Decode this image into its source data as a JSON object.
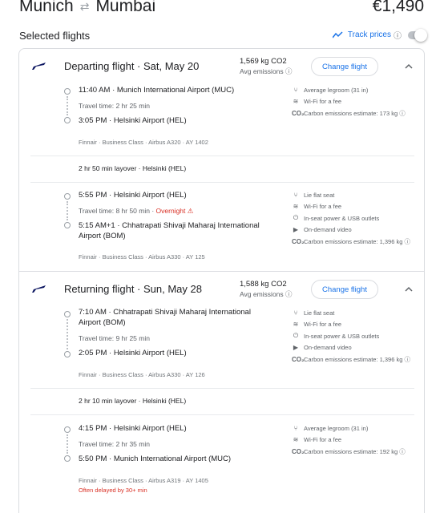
{
  "header": {
    "origin": "Munich",
    "destination": "Mumbai",
    "swap_icon": "swap-arrows-icon",
    "price": "€1,490"
  },
  "selected_title": "Selected flights",
  "track": {
    "label": "Track prices",
    "info_icon": "ⓘ"
  },
  "departing": {
    "title": "Departing flight · Sat, May 20",
    "co2": "1,569 kg CO2",
    "co2_sub": "Avg emissions ⓘ",
    "change": "Change flight",
    "seg1": {
      "dep_time_airport": "11:40 AM · Munich International Airport (MUC)",
      "travel": "Travel time: 2 hr 25 min",
      "arr_time_airport": "3:05 PM · Helsinki Airport (HEL)",
      "meta": "Finnair · Business Class · Airbus A320 · AY 1402",
      "amenities": [
        "Average legroom (31 in)",
        "Wi-Fi for a fee",
        "Carbon emissions estimate: 173 kg ⓘ"
      ]
    },
    "layover": "2 hr 50 min layover · Helsinki (HEL)",
    "seg2": {
      "dep_time_airport": "5:55 PM · Helsinki Airport (HEL)",
      "travel": "Travel time: 8 hr 50 min ·",
      "overnight": "Overnight",
      "arr_time_airport": "5:15 AM+1 · Chhatrapati Shivaji Maharaj International Airport (BOM)",
      "meta": "Finnair · Business Class · Airbus A330 · AY 125",
      "amenities": [
        "Lie flat seat",
        "Wi-Fi for a fee",
        "In-seat power & USB outlets",
        "On-demand video",
        "Carbon emissions estimate: 1,396 kg ⓘ"
      ]
    }
  },
  "returning": {
    "title": "Returning flight · Sun, May 28",
    "co2": "1,588 kg CO2",
    "co2_sub": "Avg emissions ⓘ",
    "change": "Change flight",
    "seg1": {
      "dep_time_airport": "7:10 AM · Chhatrapati Shivaji Maharaj International Airport (BOM)",
      "travel": "Travel time: 9 hr 25 min",
      "arr_time_airport": "2:05 PM · Helsinki Airport (HEL)",
      "meta": "Finnair · Business Class · Airbus A330 · AY 126",
      "amenities": [
        "Lie flat seat",
        "Wi-Fi for a fee",
        "In-seat power & USB outlets",
        "On-demand video",
        "Carbon emissions estimate: 1,396 kg ⓘ"
      ]
    },
    "layover": "2 hr 10 min layover · Helsinki (HEL)",
    "seg2": {
      "dep_time_airport": "4:15 PM · Helsinki Airport (HEL)",
      "travel": "Travel time: 2 hr 35 min",
      "arr_time_airport": "5:50 PM · Munich International Airport (MUC)",
      "meta": "Finnair · Business Class · Airbus A319 · AY 1405",
      "delay": "Often delayed by 30+ min",
      "amenities": [
        "Average legroom (31 in)",
        "Wi-Fi for a fee",
        "Carbon emissions estimate: 192 kg ⓘ"
      ]
    }
  },
  "colors": {
    "accent": "#1a73e8",
    "warning": "#d93025",
    "border": "#dadce0"
  }
}
